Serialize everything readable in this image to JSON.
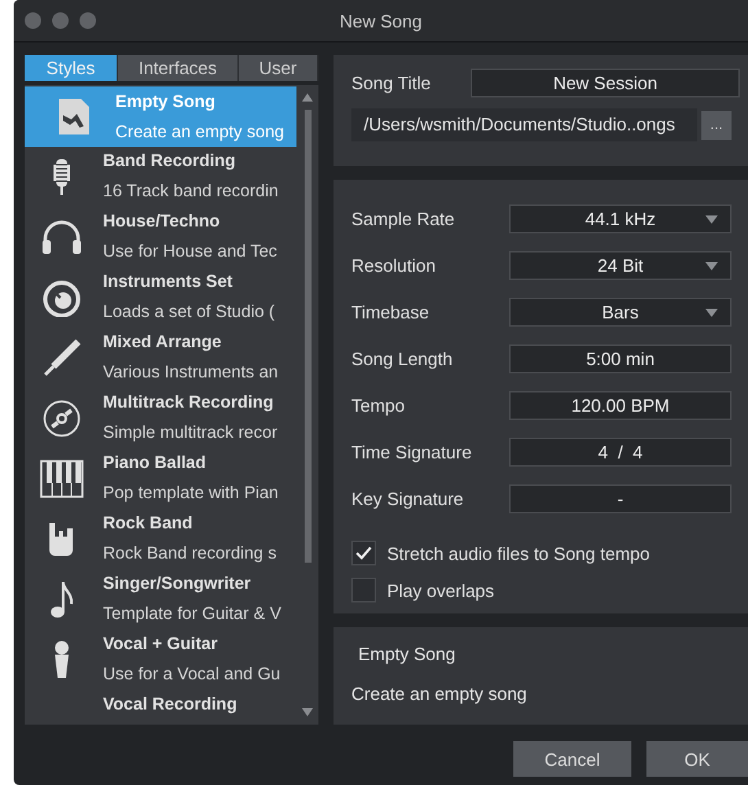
{
  "window": {
    "title": "New Song"
  },
  "tabs": [
    {
      "label": "Styles",
      "selected": true
    },
    {
      "label": "Interfaces",
      "selected": false
    },
    {
      "label": "User",
      "selected": false
    }
  ],
  "templates": [
    {
      "name": "Empty Song",
      "description": "Create an empty song",
      "selected": true
    },
    {
      "name": "Band Recording",
      "description": "16 Track band recordin",
      "selected": false
    },
    {
      "name": "House/Techno",
      "description": "Use for House and Tec",
      "selected": false
    },
    {
      "name": "Instruments Set",
      "description": "Loads a set of  Studio (",
      "selected": false
    },
    {
      "name": "Mixed Arrange",
      "description": "Various Instruments an",
      "selected": false
    },
    {
      "name": "Multitrack Recording",
      "description": "Simple multitrack recor",
      "selected": false
    },
    {
      "name": "Piano Ballad",
      "description": "Pop template with Pian",
      "selected": false
    },
    {
      "name": "Rock Band",
      "description": "Rock Band recording s",
      "selected": false
    },
    {
      "name": "Singer/Songwriter",
      "description": "Template for Guitar & V",
      "selected": false
    },
    {
      "name": "Vocal + Guitar",
      "description": "Use for a Vocal and Gu",
      "selected": false
    },
    {
      "name": "Vocal Recording",
      "selected": false
    }
  ],
  "song_title": {
    "label": "Song Title",
    "value": "New Session"
  },
  "path": {
    "value": "/Users/wsmith/Documents/Studio..ongs",
    "browse_button": "..."
  },
  "settings": [
    {
      "kind": "select",
      "label": "Sample Rate",
      "value": "44.1 kHz"
    },
    {
      "kind": "select",
      "label": "Resolution",
      "value": "24 Bit"
    },
    {
      "kind": "select",
      "label": "Timebase",
      "value": "Bars"
    },
    {
      "kind": "field",
      "label": "Song Length",
      "value": "5:00 min"
    },
    {
      "kind": "field",
      "label": "Tempo",
      "value": "120.00 BPM"
    },
    {
      "kind": "field",
      "label": "Time Signature",
      "value": "4  /  4"
    },
    {
      "kind": "field",
      "label": "Key Signature",
      "value": "-"
    }
  ],
  "options": [
    {
      "label": "Stretch audio files to Song tempo",
      "checked": true
    },
    {
      "label": "Play overlaps",
      "checked": false
    }
  ],
  "description": {
    "title": "Empty Song",
    "text": "Create an empty song"
  },
  "buttons": [
    {
      "label": "Cancel"
    },
    {
      "label": "OK"
    }
  ]
}
